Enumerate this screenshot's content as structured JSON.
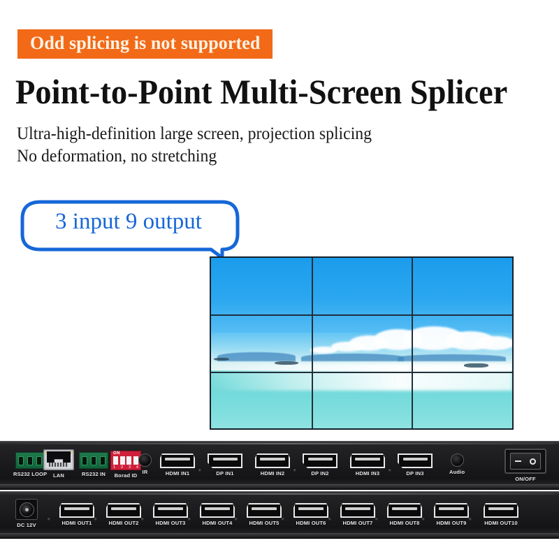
{
  "header": {
    "badge": "Odd splicing is not supported",
    "title": "Point-to-Point Multi-Screen Splicer",
    "subtitle_line1": "Ultra-high-definition large screen, projection splicing",
    "subtitle_line2": "No deformation, no stretching"
  },
  "callout": {
    "text": "3 input 9 output"
  },
  "video_wall": {
    "rows": 3,
    "cols": 3,
    "scene": "tropical-beach-photo"
  },
  "device": {
    "top_row_ports": [
      {
        "label": "RS232 LOOP",
        "type": "phoenix"
      },
      {
        "label": "LAN",
        "type": "rj45"
      },
      {
        "label": "RS232 IN",
        "type": "phoenix"
      },
      {
        "label": "Borad ID",
        "type": "dip"
      },
      {
        "label": "IR",
        "type": "jack"
      },
      {
        "label": "HDMI IN1",
        "type": "hdmi"
      },
      {
        "label": "DP IN1",
        "type": "dp"
      },
      {
        "label": "HDMI IN2",
        "type": "hdmi"
      },
      {
        "label": "DP IN2",
        "type": "dp"
      },
      {
        "label": "HDMI IN3",
        "type": "hdmi"
      },
      {
        "label": "DP IN3",
        "type": "dp"
      },
      {
        "label": "Audio",
        "type": "jack"
      },
      {
        "label": "ON/OFF",
        "type": "rocker"
      }
    ],
    "bottom_row_ports": [
      {
        "label": "DC 12V",
        "type": "dc"
      },
      {
        "label": "HDMI OUT1",
        "type": "hdmi"
      },
      {
        "label": "HDMI OUT2",
        "type": "hdmi"
      },
      {
        "label": "HDMI OUT3",
        "type": "hdmi"
      },
      {
        "label": "HDMI OUT4",
        "type": "hdmi"
      },
      {
        "label": "HDMI OUT5",
        "type": "hdmi"
      },
      {
        "label": "HDMI OUT6",
        "type": "hdmi"
      },
      {
        "label": "HDMI OUT7",
        "type": "hdmi"
      },
      {
        "label": "HDMI OUT8",
        "type": "hdmi"
      },
      {
        "label": "HDMI OUT9",
        "type": "hdmi"
      },
      {
        "label": "HDMI OUT10",
        "type": "hdmi"
      }
    ],
    "dip_switch": {
      "on_label": "ON",
      "numbers": [
        "1",
        "2",
        "3",
        "4"
      ]
    }
  },
  "colors": {
    "badge_bg": "#F26A17",
    "badge_text": "#FDF3E6",
    "callout_blue": "#1667D8",
    "panel_dark": "#1b1b1d",
    "terminal_green": "#1f7a4a",
    "dip_red": "#cf1f3a"
  }
}
